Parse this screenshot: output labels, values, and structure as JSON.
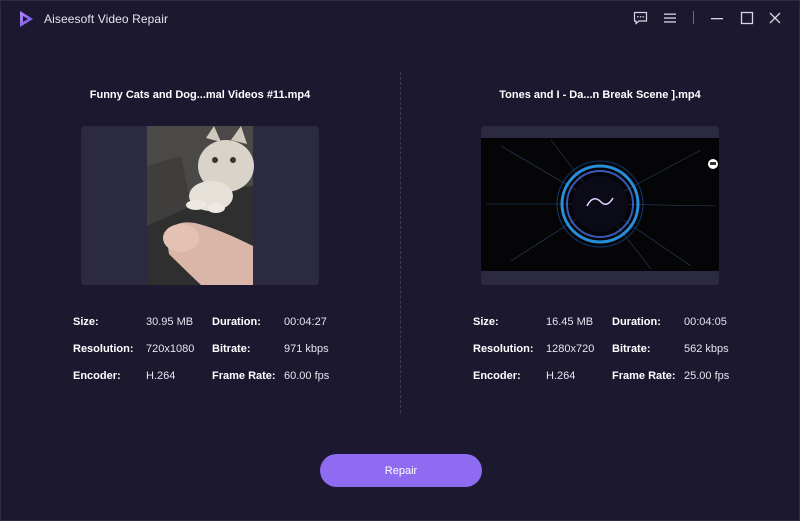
{
  "app": {
    "title": "Aiseesoft Video Repair"
  },
  "titlebar_icons": [
    "feedback-icon",
    "menu-icon",
    "minimize-icon",
    "maximize-icon",
    "close-icon"
  ],
  "left_video": {
    "filename": "Funny Cats and Dog...mal Videos #11.mp4",
    "info": {
      "size_label": "Size:",
      "size_value": "30.95 MB",
      "duration_label": "Duration:",
      "duration_value": "00:04:27",
      "resolution_label": "Resolution:",
      "resolution_value": "720x1080",
      "bitrate_label": "Bitrate:",
      "bitrate_value": "971 kbps",
      "encoder_label": "Encoder:",
      "encoder_value": "H.264",
      "framerate_label": "Frame Rate:",
      "framerate_value": "60.00 fps"
    }
  },
  "right_video": {
    "filename": "Tones and I   -   Da...n Break Scene ].mp4",
    "info": {
      "size_label": "Size:",
      "size_value": "16.45 MB",
      "duration_label": "Duration:",
      "duration_value": "00:04:05",
      "resolution_label": "Resolution:",
      "resolution_value": "1280x720",
      "bitrate_label": "Bitrate:",
      "bitrate_value": "562 kbps",
      "encoder_label": "Encoder:",
      "encoder_value": "H.264",
      "framerate_label": "Frame Rate:",
      "framerate_value": "25.00 fps"
    }
  },
  "actions": {
    "repair_label": "Repair"
  },
  "colors": {
    "background": "#1b1830",
    "accent": "#8e6bf0",
    "preview_bg": "#2c2942"
  }
}
